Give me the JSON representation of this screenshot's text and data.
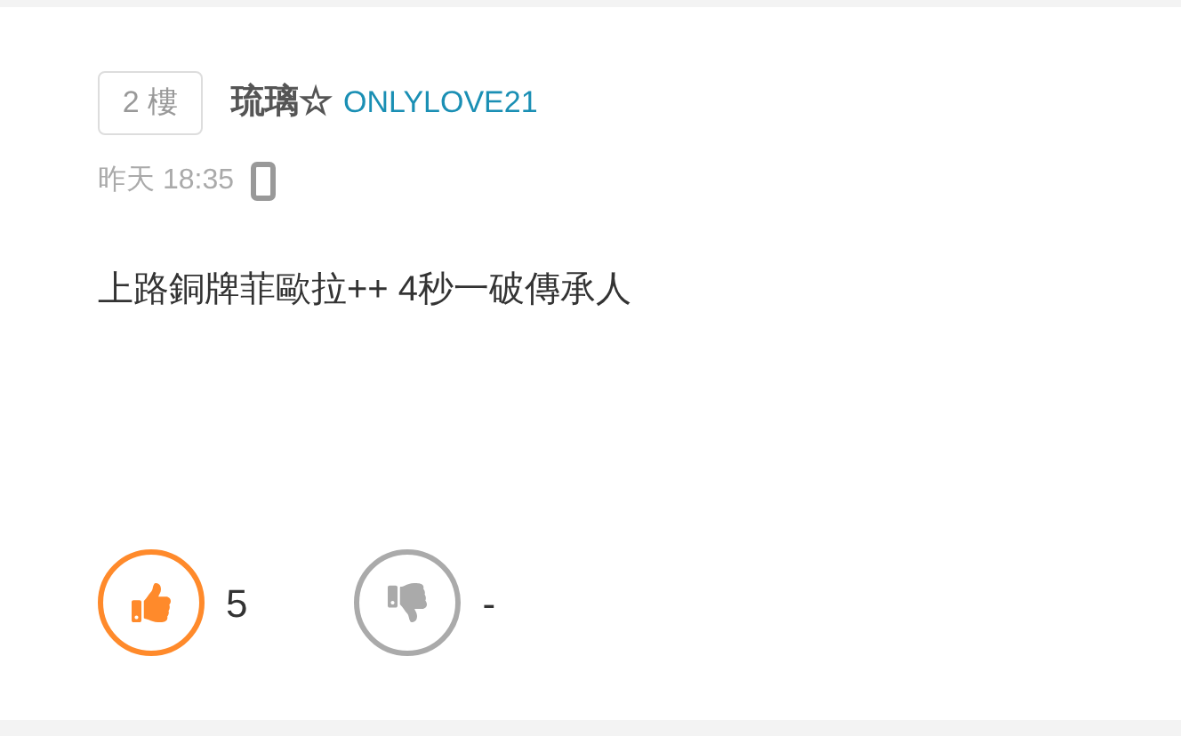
{
  "post": {
    "floor": "2 樓",
    "author": "琉璃☆",
    "user_id": "ONLYLOVE21",
    "time": "昨天 18:35",
    "body": "上路銅牌菲歐拉++ 4秒一破傳承人"
  },
  "votes": [
    {
      "kind": "like",
      "count": "5",
      "selected": true
    },
    {
      "kind": "dislike",
      "count": "-",
      "selected": false
    }
  ]
}
